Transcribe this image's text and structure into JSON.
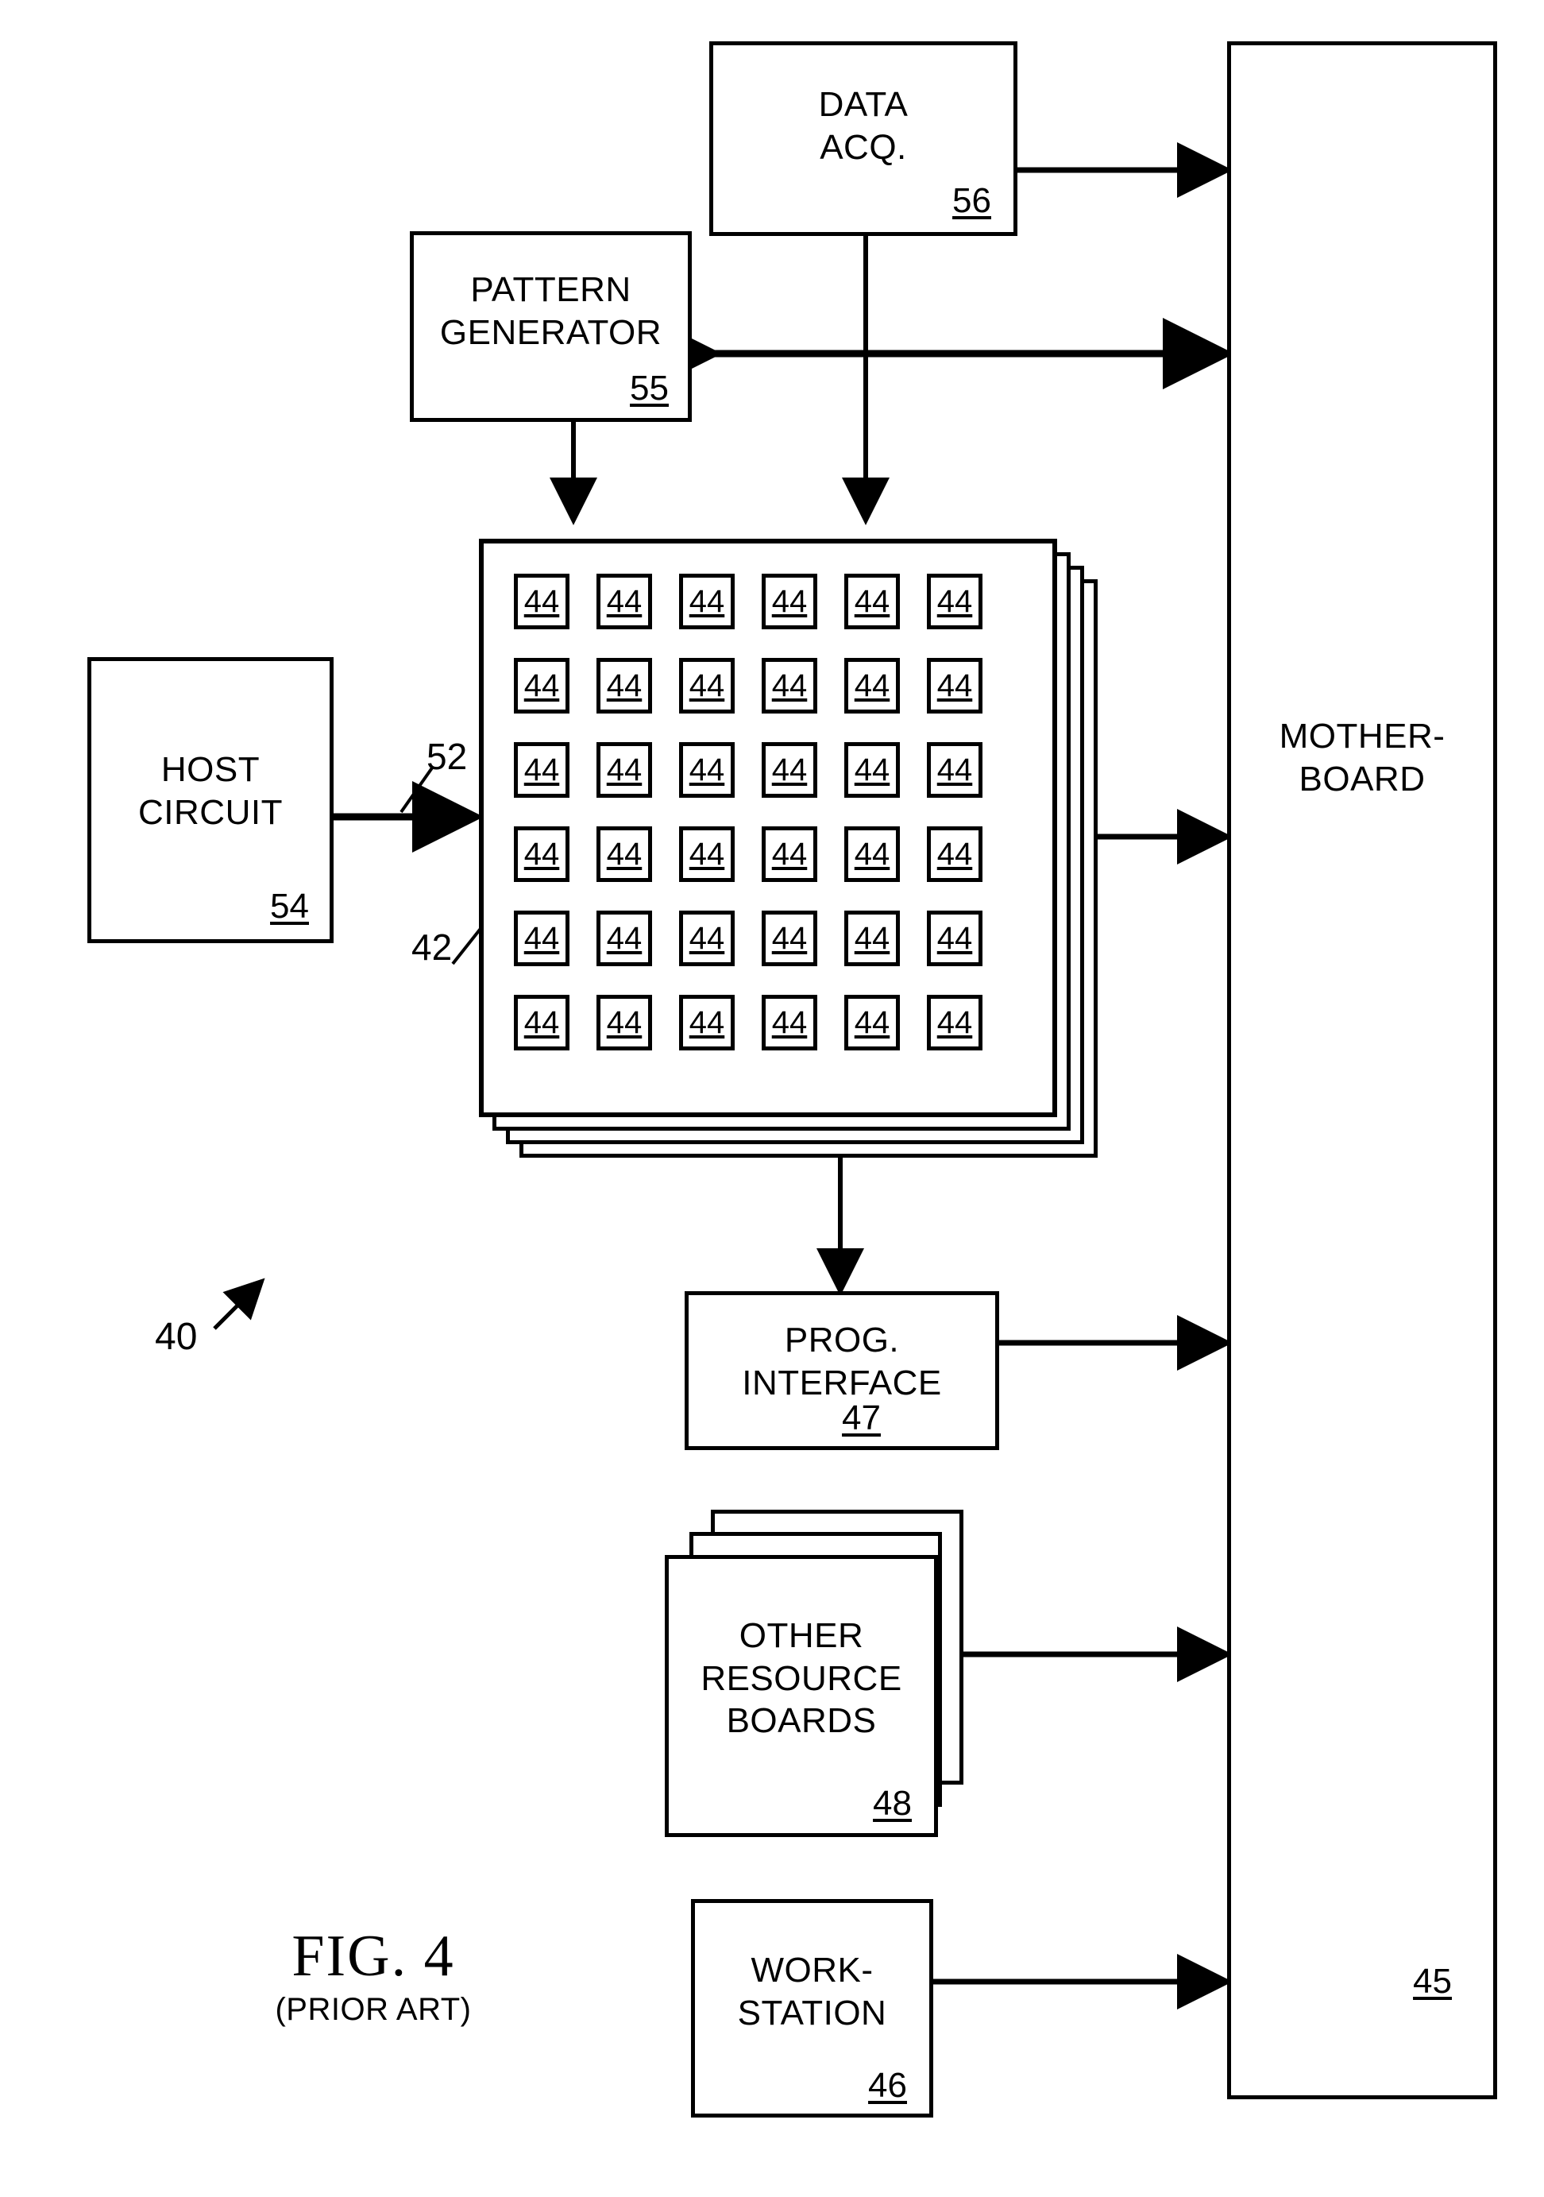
{
  "figure": {
    "title": "FIG. 4",
    "subtitle": "(PRIOR ART)",
    "system_ref": "40"
  },
  "blocks": {
    "data_acq": {
      "line1": "DATA",
      "line2": "ACQ.",
      "ref": "56"
    },
    "pattern_generator": {
      "line1": "PATTERN",
      "line2": "GENERATOR",
      "ref": "55"
    },
    "host_circuit": {
      "line1": "HOST",
      "line2": "CIRCUIT",
      "ref": "54"
    },
    "motherboard": {
      "line1": "MOTHER-",
      "line2": "BOARD",
      "ref": "45"
    },
    "prog_interface": {
      "line1": "PROG.",
      "line2": "INTERFACE",
      "ref": "47"
    },
    "other_resource_boards": {
      "line1": "OTHER",
      "line2": "RESOURCE",
      "line3": "BOARDS",
      "ref": "48"
    },
    "workstation": {
      "line1": "WORK-",
      "line2": "STATION",
      "ref": "46"
    }
  },
  "resource_board": {
    "stack_ref": "42",
    "bus_ref": "52",
    "cell_ref": "44",
    "grid_rows": 6,
    "grid_cols": 6,
    "boards_in_stack": 4,
    "cells": [
      [
        "44",
        "44",
        "44",
        "44",
        "44",
        "44"
      ],
      [
        "44",
        "44",
        "44",
        "44",
        "44",
        "44"
      ],
      [
        "44",
        "44",
        "44",
        "44",
        "44",
        "44"
      ],
      [
        "44",
        "44",
        "44",
        "44",
        "44",
        "44"
      ],
      [
        "44",
        "44",
        "44",
        "44",
        "44",
        "44"
      ],
      [
        "44",
        "44",
        "44",
        "44",
        "44",
        "44"
      ]
    ]
  },
  "colors": {
    "ink": "#000000",
    "paper": "#ffffff"
  }
}
